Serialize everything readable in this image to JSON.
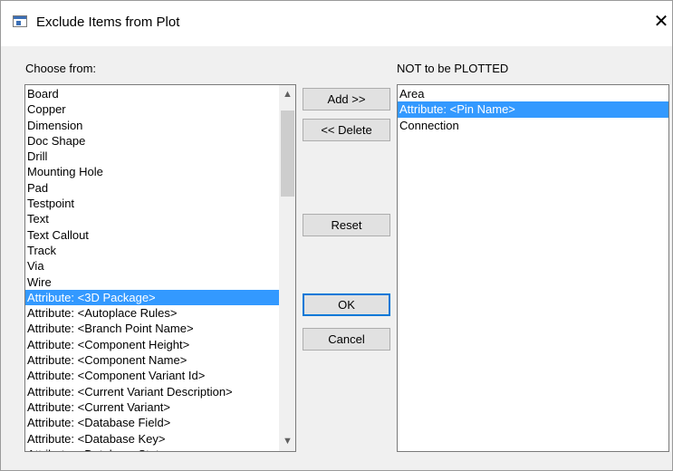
{
  "window": {
    "title": "Exclude Items from Plot",
    "close_glyph": "✕"
  },
  "left": {
    "label": "Choose from:",
    "selected_index": 13,
    "items": [
      "Board",
      "Copper",
      "Dimension",
      "Doc Shape",
      "Drill",
      "Mounting Hole",
      "Pad",
      "Testpoint",
      "Text",
      "Text Callout",
      "Track",
      "Via",
      "Wire",
      "Attribute: <3D Package>",
      "Attribute: <Autoplace Rules>",
      "Attribute: <Branch Point Name>",
      "Attribute: <Component Height>",
      "Attribute: <Component Name>",
      "Attribute: <Component Variant Id>",
      "Attribute: <Current Variant Description>",
      "Attribute: <Current Variant>",
      "Attribute: <Database Field>",
      "Attribute: <Database Key>",
      "Attribute: <Database Status>"
    ],
    "scroll_up_glyph": "▲",
    "scroll_down_glyph": "▼"
  },
  "right": {
    "label": "NOT to be PLOTTED",
    "selected_index": 1,
    "items": [
      "Area",
      "Attribute: <Pin Name>",
      "Connection"
    ]
  },
  "buttons": {
    "add": "Add >>",
    "delete": "<< Delete",
    "reset": "Reset",
    "ok": "OK",
    "cancel": "Cancel"
  },
  "colors": {
    "selection": "#3399ff",
    "default_button_border": "#0078d7"
  }
}
